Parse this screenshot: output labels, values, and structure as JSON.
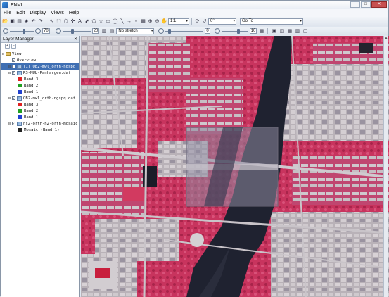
{
  "window": {
    "title": "ENVI"
  },
  "menu": [
    "File",
    "Edit",
    "Display",
    "Views",
    "Help"
  ],
  "toolbar": {
    "zoom_value": "1:1",
    "rotation_value": "0°",
    "goto_placeholder": "Go To",
    "stretch_value": "No stretch",
    "brightness_value": "70",
    "contrast_value": "20",
    "sharpen_value": "0",
    "transparency_value": "10"
  },
  "layer_manager": {
    "title": "Layer Manager",
    "tree": [
      {
        "label": "View",
        "indent": 0,
        "type": "folder"
      },
      {
        "label": "Overview",
        "indent": 1,
        "type": "item"
      },
      {
        "label": "[1] QB2-mwl_orth-ngspq",
        "indent": 1,
        "type": "layer",
        "selected": true
      },
      {
        "label": "RS-MUL-Panhargen.dat",
        "indent": 1,
        "type": "layer"
      },
      {
        "label": "Band 3",
        "indent": 2,
        "type": "band",
        "color": "#e02020"
      },
      {
        "label": "Band 2",
        "indent": 2,
        "type": "band",
        "color": "#20a020"
      },
      {
        "label": "Band 1",
        "indent": 2,
        "type": "band",
        "color": "#2040d0"
      },
      {
        "label": "QB2-mwl_orth-ngspq.dat",
        "indent": 1,
        "type": "layer"
      },
      {
        "label": "Band 3",
        "indent": 2,
        "type": "band",
        "color": "#e02020"
      },
      {
        "label": "Band 2",
        "indent": 2,
        "type": "band",
        "color": "#20a020"
      },
      {
        "label": "Band 1",
        "indent": 2,
        "type": "band",
        "color": "#2040d0"
      },
      {
        "label": "hs2-orth-h2-orth-mosaic",
        "indent": 1,
        "type": "layer"
      },
      {
        "label": "Mosaic (Band 1)",
        "indent": 2,
        "type": "band",
        "color": "#222222"
      }
    ]
  },
  "colors": {
    "vegetation": "#c8345e",
    "urban": "#b7b0b6",
    "water": "#1f2230",
    "accent": "#3f6fb3"
  }
}
